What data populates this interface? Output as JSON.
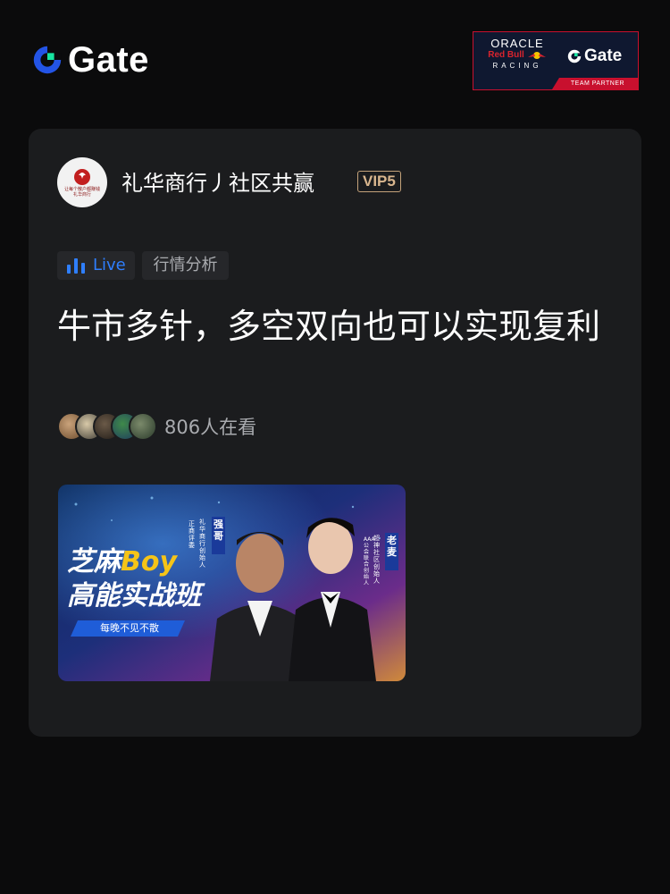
{
  "header": {
    "brand_name": "Gate",
    "brand_icon": "gate-logo-icon",
    "partner": {
      "oracle": "ORACLE",
      "redbull": "Red Bull",
      "racing": "RACING",
      "brand": "Gate",
      "badge": "TEAM PARTNER"
    }
  },
  "post": {
    "avatar_text": "让每个散户都赚钱",
    "avatar_subtext": "礼华商行",
    "username": "礼华商行丿社区共赢",
    "vip_label": "VIP5",
    "live_label": "Live",
    "category_label": "行情分析",
    "title": "牛市多针，多空双向也可以实现复利",
    "viewers_text": "806人在看",
    "cover": {
      "line1_a": "芝麻",
      "line1_b": "Boy",
      "line2": "高能实战班",
      "slogan": "每晚不见不散",
      "host1_name": "强哥",
      "host1_desc1": "礼华商行创始人",
      "host1_desc2": "正商评委",
      "host2_name": "老麦",
      "host2_desc1": "超神社区创始人",
      "host2_desc2": "AAA公会联合创始人"
    }
  },
  "colors": {
    "background": "#0b0b0c",
    "card": "#1b1c1e",
    "accent_blue": "#2f7fff",
    "vip_gold": "#d9b68e",
    "muted_text": "#a9abaf"
  }
}
